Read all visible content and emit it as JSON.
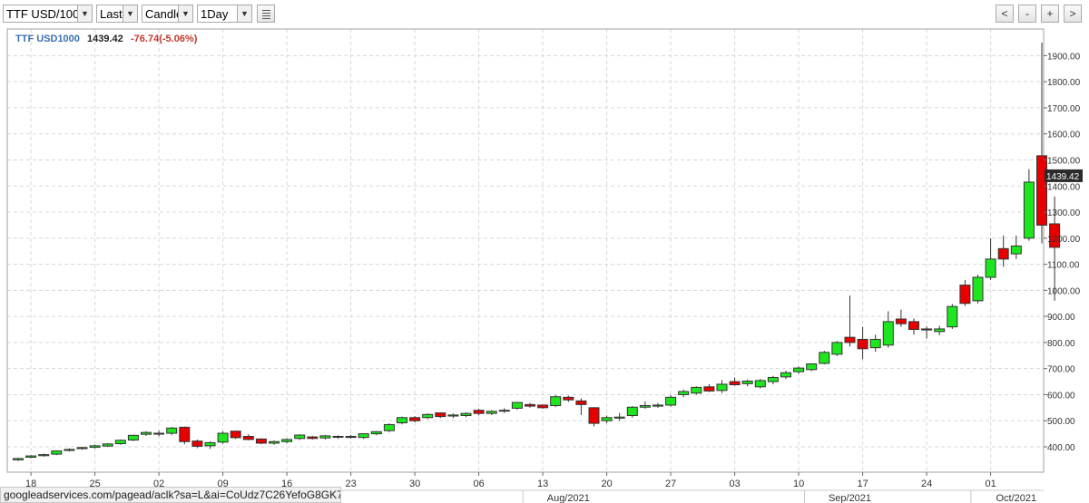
{
  "toolbar": {
    "symbol": "TTF USD/100",
    "field": "Last",
    "chart_type": "Candle",
    "interval": "1Day",
    "zoom_buttons": [
      "<",
      "-",
      "+",
      ">"
    ]
  },
  "legend": {
    "symbol": "TTF USD1000",
    "last": "1439.42",
    "change": "-76.74(-5.06%)",
    "symbol_color": "#3a6fb0",
    "change_color": "#c0392b"
  },
  "status_url": "googleadservices.com/pagead/aclk?sa=L&ai=CoUdz7C26YefoG8GK7A...",
  "colors": {
    "up": "#1ee61e",
    "down": "#e60000",
    "grid": "#d8d8d8",
    "label_bg": "#2b2b2b"
  },
  "chart_data": {
    "type": "candlestick",
    "current_price_label": "1439.42",
    "ylim": [
      330,
      1980
    ],
    "yticks": [
      400,
      500,
      600,
      700,
      800,
      900,
      1000,
      1100,
      1200,
      1300,
      1400,
      1500,
      1600,
      1700,
      1800,
      1900
    ],
    "ytick_labels": [
      "400.00",
      "500.00",
      "600.00",
      "700.00",
      "800.00",
      "900.00",
      "1000.00",
      "1100.00",
      "1200.00",
      "1300.00",
      "1400.00",
      "1500.00",
      "1600.00",
      "1700.00",
      "1800.00",
      "1900.00"
    ],
    "x_tick_labels": [
      "18",
      "25",
      "02",
      "09",
      "16",
      "23",
      "30",
      "06",
      "13",
      "20",
      "27",
      "03",
      "10",
      "17",
      "24",
      "01"
    ],
    "x_tick_index": [
      1,
      6,
      11,
      16,
      21,
      26,
      31,
      36,
      41,
      46,
      51,
      56,
      61,
      66,
      71,
      76
    ],
    "month_labels": [
      {
        "label": "Aug/2021",
        "index": 43
      },
      {
        "label": "Sep/2021",
        "index": 65
      },
      {
        "label": "Oct/2021",
        "index": 78
      }
    ],
    "candles": [
      {
        "o": 350,
        "h": 358,
        "l": 346,
        "c": 355
      },
      {
        "o": 360,
        "h": 368,
        "l": 356,
        "c": 365
      },
      {
        "o": 366,
        "h": 374,
        "l": 362,
        "c": 370
      },
      {
        "o": 372,
        "h": 386,
        "l": 368,
        "c": 384
      },
      {
        "o": 386,
        "h": 394,
        "l": 382,
        "c": 390
      },
      {
        "o": 393,
        "h": 400,
        "l": 389,
        "c": 397
      },
      {
        "o": 398,
        "h": 408,
        "l": 394,
        "c": 404
      },
      {
        "o": 403,
        "h": 414,
        "l": 399,
        "c": 411
      },
      {
        "o": 412,
        "h": 428,
        "l": 408,
        "c": 425
      },
      {
        "o": 426,
        "h": 446,
        "l": 422,
        "c": 444
      },
      {
        "o": 448,
        "h": 460,
        "l": 442,
        "c": 455
      },
      {
        "o": 450,
        "h": 462,
        "l": 440,
        "c": 452
      },
      {
        "o": 452,
        "h": 476,
        "l": 445,
        "c": 472
      },
      {
        "o": 475,
        "h": 478,
        "l": 410,
        "c": 420
      },
      {
        "o": 422,
        "h": 428,
        "l": 395,
        "c": 402
      },
      {
        "o": 404,
        "h": 420,
        "l": 392,
        "c": 416
      },
      {
        "o": 418,
        "h": 460,
        "l": 412,
        "c": 452
      },
      {
        "o": 460,
        "h": 462,
        "l": 430,
        "c": 435
      },
      {
        "o": 440,
        "h": 448,
        "l": 425,
        "c": 428
      },
      {
        "o": 430,
        "h": 433,
        "l": 410,
        "c": 414
      },
      {
        "o": 414,
        "h": 424,
        "l": 408,
        "c": 420
      },
      {
        "o": 420,
        "h": 432,
        "l": 414,
        "c": 428
      },
      {
        "o": 432,
        "h": 448,
        "l": 426,
        "c": 445
      },
      {
        "o": 438,
        "h": 442,
        "l": 428,
        "c": 432
      },
      {
        "o": 434,
        "h": 446,
        "l": 428,
        "c": 442
      },
      {
        "o": 438,
        "h": 444,
        "l": 430,
        "c": 440
      },
      {
        "o": 440,
        "h": 446,
        "l": 432,
        "c": 436
      },
      {
        "o": 436,
        "h": 452,
        "l": 430,
        "c": 450
      },
      {
        "o": 450,
        "h": 460,
        "l": 444,
        "c": 458
      },
      {
        "o": 462,
        "h": 490,
        "l": 456,
        "c": 485
      },
      {
        "o": 492,
        "h": 516,
        "l": 486,
        "c": 512
      },
      {
        "o": 512,
        "h": 518,
        "l": 494,
        "c": 500
      },
      {
        "o": 512,
        "h": 528,
        "l": 506,
        "c": 524
      },
      {
        "o": 530,
        "h": 532,
        "l": 510,
        "c": 516
      },
      {
        "o": 518,
        "h": 528,
        "l": 510,
        "c": 522
      },
      {
        "o": 520,
        "h": 532,
        "l": 514,
        "c": 528
      },
      {
        "o": 540,
        "h": 546,
        "l": 520,
        "c": 528
      },
      {
        "o": 528,
        "h": 540,
        "l": 522,
        "c": 536
      },
      {
        "o": 540,
        "h": 548,
        "l": 530,
        "c": 538
      },
      {
        "o": 548,
        "h": 572,
        "l": 542,
        "c": 570
      },
      {
        "o": 562,
        "h": 568,
        "l": 550,
        "c": 556
      },
      {
        "o": 560,
        "h": 562,
        "l": 546,
        "c": 550
      },
      {
        "o": 558,
        "h": 598,
        "l": 552,
        "c": 592
      },
      {
        "o": 590,
        "h": 596,
        "l": 572,
        "c": 580
      },
      {
        "o": 576,
        "h": 586,
        "l": 522,
        "c": 562
      },
      {
        "o": 550,
        "h": 552,
        "l": 478,
        "c": 490
      },
      {
        "o": 500,
        "h": 520,
        "l": 490,
        "c": 512
      },
      {
        "o": 510,
        "h": 530,
        "l": 500,
        "c": 514
      },
      {
        "o": 520,
        "h": 556,
        "l": 512,
        "c": 552
      },
      {
        "o": 552,
        "h": 574,
        "l": 546,
        "c": 558
      },
      {
        "o": 556,
        "h": 568,
        "l": 550,
        "c": 560
      },
      {
        "o": 560,
        "h": 598,
        "l": 554,
        "c": 590
      },
      {
        "o": 600,
        "h": 620,
        "l": 590,
        "c": 612
      },
      {
        "o": 606,
        "h": 632,
        "l": 600,
        "c": 628
      },
      {
        "o": 630,
        "h": 640,
        "l": 610,
        "c": 614
      },
      {
        "o": 616,
        "h": 656,
        "l": 606,
        "c": 640
      },
      {
        "o": 650,
        "h": 666,
        "l": 634,
        "c": 638
      },
      {
        "o": 642,
        "h": 658,
        "l": 632,
        "c": 652
      },
      {
        "o": 630,
        "h": 660,
        "l": 624,
        "c": 654
      },
      {
        "o": 650,
        "h": 672,
        "l": 640,
        "c": 666
      },
      {
        "o": 668,
        "h": 692,
        "l": 660,
        "c": 684
      },
      {
        "o": 688,
        "h": 708,
        "l": 680,
        "c": 702
      },
      {
        "o": 696,
        "h": 720,
        "l": 690,
        "c": 718
      },
      {
        "o": 720,
        "h": 768,
        "l": 716,
        "c": 762
      },
      {
        "o": 755,
        "h": 806,
        "l": 748,
        "c": 800
      },
      {
        "o": 820,
        "h": 980,
        "l": 785,
        "c": 800
      },
      {
        "o": 812,
        "h": 860,
        "l": 736,
        "c": 776
      },
      {
        "o": 780,
        "h": 830,
        "l": 765,
        "c": 812
      },
      {
        "o": 790,
        "h": 920,
        "l": 780,
        "c": 880
      },
      {
        "o": 890,
        "h": 926,
        "l": 860,
        "c": 872
      },
      {
        "o": 880,
        "h": 892,
        "l": 830,
        "c": 850
      },
      {
        "o": 852,
        "h": 862,
        "l": 815,
        "c": 848
      },
      {
        "o": 842,
        "h": 864,
        "l": 828,
        "c": 852
      },
      {
        "o": 860,
        "h": 948,
        "l": 852,
        "c": 938
      },
      {
        "o": 1020,
        "h": 1040,
        "l": 940,
        "c": 950
      },
      {
        "o": 960,
        "h": 1060,
        "l": 950,
        "c": 1050
      },
      {
        "o": 1050,
        "h": 1200,
        "l": 1040,
        "c": 1120
      },
      {
        "o": 1160,
        "h": 1210,
        "l": 1090,
        "c": 1120
      },
      {
        "o": 1140,
        "h": 1210,
        "l": 1120,
        "c": 1170
      },
      {
        "o": 1200,
        "h": 1465,
        "l": 1190,
        "c": 1415
      },
      {
        "o": 1516,
        "h": 1950,
        "l": 1180,
        "c": 1250
      },
      {
        "o": 1255,
        "h": 1360,
        "l": 960,
        "c": 1165
      }
    ]
  }
}
